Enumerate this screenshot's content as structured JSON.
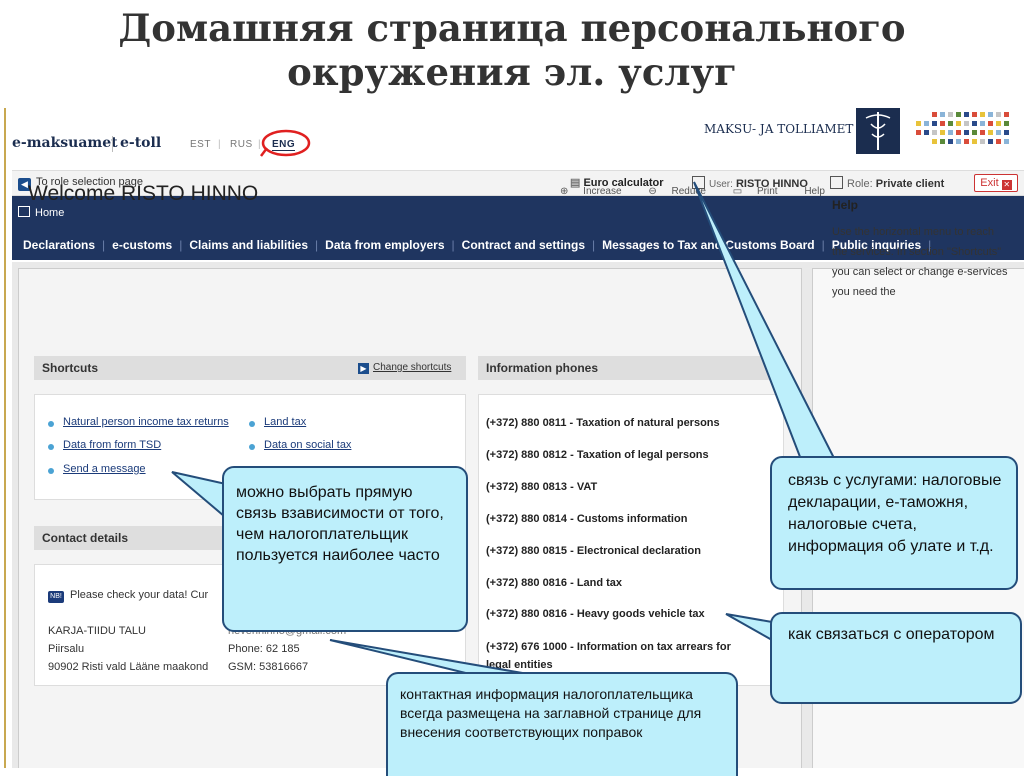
{
  "slide": {
    "title_line1": "Домашняя страница персонального",
    "title_line2": "окружения эл. услуг"
  },
  "topbar": {
    "logo_emaksuamet": "e-maksuamet",
    "logo_etoll": "e-toll",
    "languages": [
      "EST",
      "RUS",
      "ENG"
    ],
    "active_language": "ENG",
    "agency_name": "MAKSU- JA TOLLIAMET"
  },
  "actionbar": {
    "role_selection": "To role selection page",
    "euro_calculator": "Euro calculator",
    "user_label": "User:",
    "user_name": "RISTO HINNO",
    "role_label": "Role:",
    "role_value": "Private client",
    "exit_label": "Exit"
  },
  "nav": {
    "home": "Home",
    "menu": [
      "Declarations",
      "e-customs",
      "Claims and liabilities",
      "Data from employers",
      "Contract and settings",
      "Messages to Tax and Customs Board",
      "Public inquiries"
    ]
  },
  "main": {
    "welcome": "Welcome RISTO HINNO",
    "tools": [
      "Increase",
      "Reduce",
      "Print",
      "Help"
    ],
    "shortcuts": {
      "title": "Shortcuts",
      "change_label": "Change shortcuts",
      "links": [
        "Natural person income tax returns",
        "Land tax",
        "Data from form TSD",
        "Data on social tax",
        "Send a message"
      ]
    },
    "contact": {
      "title": "Contact details",
      "notice": "Please check your data! Cur",
      "name": "KARJA-TIIDU TALU",
      "address_line1": "Piirsalu",
      "address_line2": "90902 Risti vald Lääne maakond",
      "email_partial": "nevenhinno@gmail.com",
      "phone": "Phone: 62 185",
      "gsm": "GSM: 53816667"
    },
    "phones": {
      "title": "Information phones",
      "items": [
        "(+372) 880 0811 - Taxation of natural persons",
        "(+372) 880 0812 - Taxation of legal persons",
        "(+372) 880 0813 - VAT",
        "(+372) 880 0814 - Customs information",
        "(+372) 880 0815 - Electronical declaration",
        "(+372) 880 0816 - Land tax",
        "(+372) 880 0816 - Heavy goods vehicle tax",
        "(+372) 676 1000 - Information on tax arrears for legal entities"
      ]
    }
  },
  "help": {
    "title": "Help",
    "text": "Use the horizontal menu to reach the services. In section \"Shortcuts\" you can select or change e-services you need the"
  },
  "callouts": {
    "shortcuts_note": "можно выбрать прямую связь взависимости от того, чем налогоплательщик пользуется наиболее часто",
    "services_note": "связь с услугами: налоговые декларации, е-таможня, налоговые счета, информация об улате и т.д.",
    "operator_note": "как связаться с оператором",
    "contact_note": "контактная информация налогоплательщика всегда размещена на заглавной странице для внесения соответствующих поправок"
  },
  "colors": {
    "navy": "#1f3560",
    "callout_fill": "#bdeffb",
    "callout_border": "#244d7a",
    "highlight_ring": "#e02020"
  }
}
